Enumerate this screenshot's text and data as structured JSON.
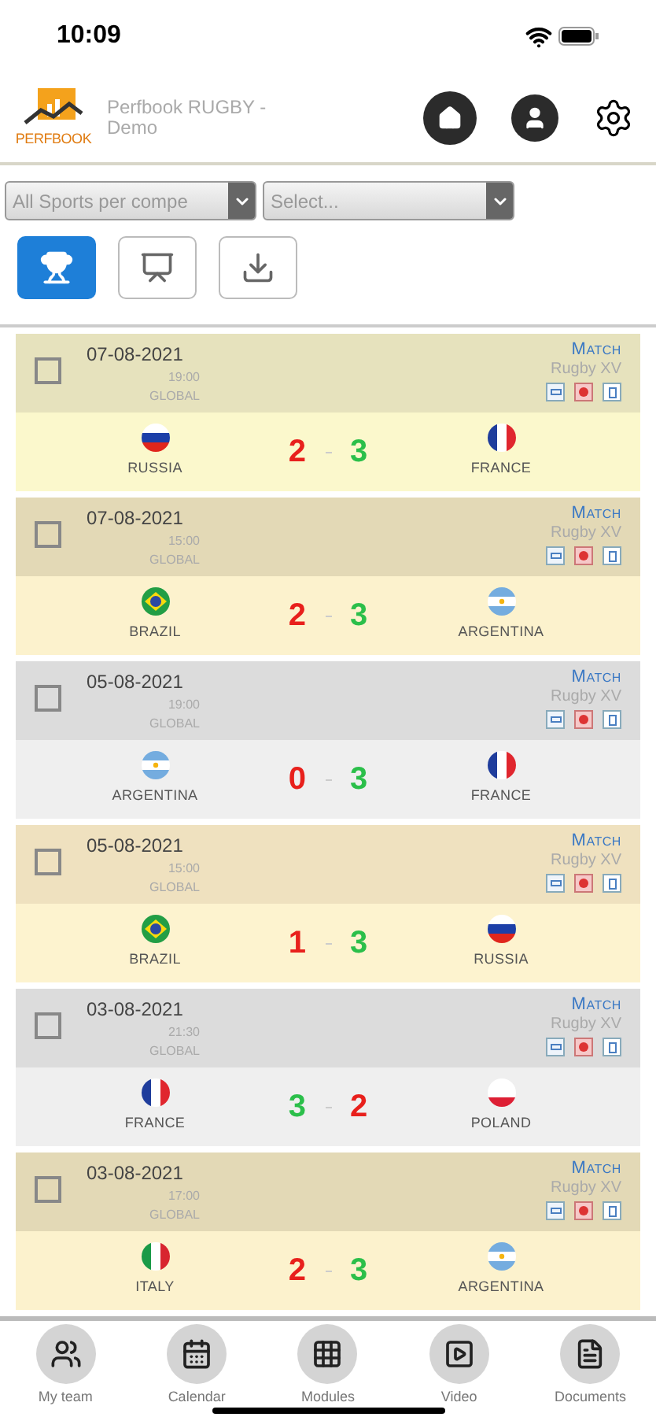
{
  "status_bar": {
    "time": "10:09"
  },
  "header": {
    "logo_text": "PERFBOOK",
    "title": "Perfbook RUGBY - Demo"
  },
  "filters": [
    {
      "value": "All Sports per compe"
    },
    {
      "value": "Select..."
    }
  ],
  "view_buttons": [
    {
      "kind": "trophy",
      "selected": true
    },
    {
      "kind": "presentation",
      "selected": false
    },
    {
      "kind": "download",
      "selected": false
    }
  ],
  "matches": [
    {
      "kind": "olive",
      "checked": false,
      "date": "07-08-2021",
      "time": "19:00",
      "scope": "GLOBAL",
      "type": "Match",
      "sport": "Rugby XV",
      "home": {
        "name": "RUSSIA",
        "kind": "ru",
        "score": "2",
        "won": false
      },
      "away": {
        "name": "FRANCE",
        "kind": "fr",
        "score": "3",
        "won": true
      }
    },
    {
      "kind": "tan",
      "checked": false,
      "date": "07-08-2021",
      "time": "15:00",
      "scope": "GLOBAL",
      "type": "Match",
      "sport": "Rugby XV",
      "home": {
        "name": "BRAZIL",
        "kind": "br",
        "score": "2",
        "won": false
      },
      "away": {
        "name": "ARGENTINA",
        "kind": "ar",
        "score": "3",
        "won": true
      }
    },
    {
      "kind": "gray",
      "checked": false,
      "date": "05-08-2021",
      "time": "19:00",
      "scope": "GLOBAL",
      "type": "Match",
      "sport": "Rugby XV",
      "home": {
        "name": "ARGENTINA",
        "kind": "ar",
        "score": "0",
        "won": false
      },
      "away": {
        "name": "FRANCE",
        "kind": "fr",
        "score": "3",
        "won": true
      }
    },
    {
      "kind": "peach",
      "checked": false,
      "date": "05-08-2021",
      "time": "15:00",
      "scope": "GLOBAL",
      "type": "Match",
      "sport": "Rugby XV",
      "home": {
        "name": "BRAZIL",
        "kind": "br",
        "score": "1",
        "won": false
      },
      "away": {
        "name": "RUSSIA",
        "kind": "ru",
        "score": "3",
        "won": true
      }
    },
    {
      "kind": "gray",
      "checked": false,
      "date": "03-08-2021",
      "time": "21:30",
      "scope": "GLOBAL",
      "type": "Match",
      "sport": "Rugby XV",
      "home": {
        "name": "FRANCE",
        "kind": "fr",
        "score": "3",
        "won": true
      },
      "away": {
        "name": "POLAND",
        "kind": "pl",
        "score": "2",
        "won": false
      }
    },
    {
      "kind": "tan",
      "checked": false,
      "date": "03-08-2021",
      "time": "17:00",
      "scope": "GLOBAL",
      "type": "Match",
      "sport": "Rugby XV",
      "home": {
        "name": "ITALY",
        "kind": "it",
        "score": "2",
        "won": false
      },
      "away": {
        "name": "ARGENTINA",
        "kind": "ar",
        "score": "3",
        "won": true
      }
    }
  ],
  "tab_bar": [
    {
      "kind": "team",
      "label": "My team"
    },
    {
      "kind": "calendar",
      "label": "Calendar"
    },
    {
      "kind": "modules",
      "label": "Modules"
    },
    {
      "kind": "video",
      "label": "Video"
    },
    {
      "kind": "documents",
      "label": "Documents"
    }
  ]
}
